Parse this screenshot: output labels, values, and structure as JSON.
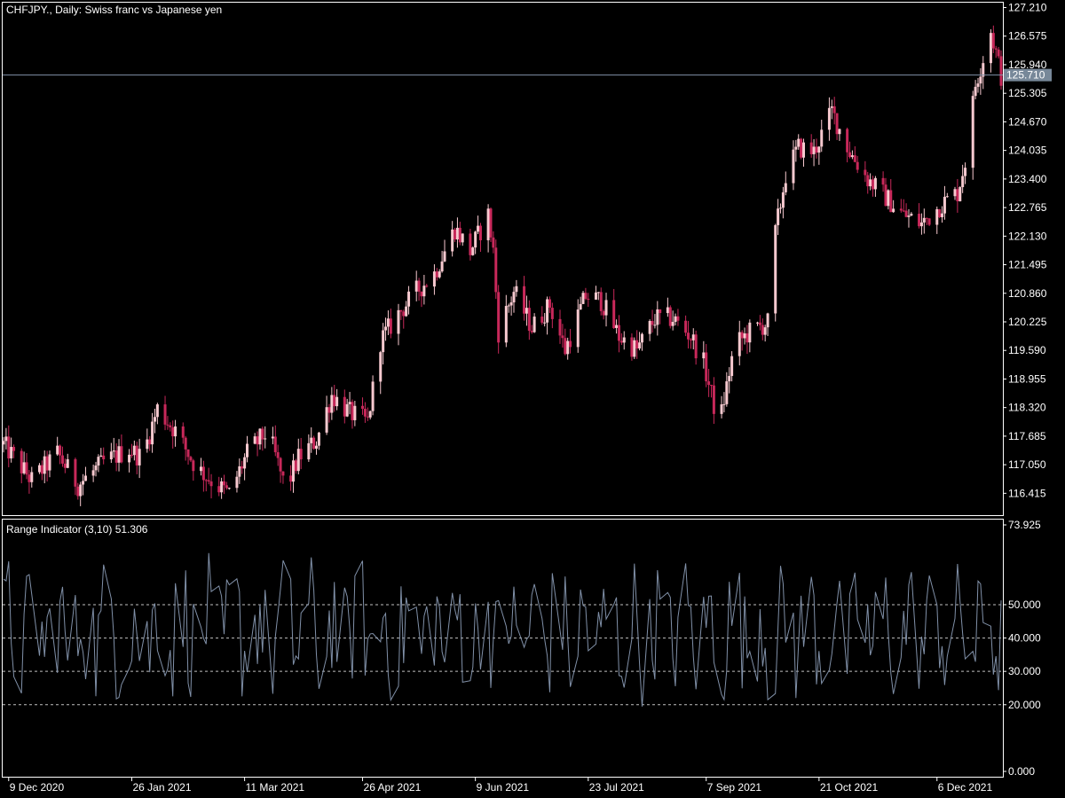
{
  "colors": {
    "background": "#000000",
    "frame": "#ffffff",
    "bull_candle": "#f7c9cf",
    "bear_candle": "#c8285a",
    "price_line": "#8090a8",
    "price_tag": "#778899",
    "indicator_line": "#8090a8",
    "level_line": "#c0c0c0"
  },
  "chart_data": [
    {
      "type": "candlestick",
      "title": "CHFJPY., Daily:  Swiss franc vs Japanese yen",
      "symbol": "CHFJPY.",
      "timeframe": "Daily",
      "ylim": [
        115.87,
        127.24
      ],
      "y_ticks": [
        "127.210",
        "126.575",
        "125.940",
        "125.305",
        "124.670",
        "124.035",
        "123.400",
        "122.765",
        "122.130",
        "121.495",
        "120.860",
        "120.225",
        "119.590",
        "118.955",
        "118.320",
        "117.685",
        "117.050",
        "116.415"
      ],
      "current_price": "125.710",
      "x_tick_labels": [
        "9 Dec 2020",
        "26 Jan 2021",
        "11 Mar 2021",
        "26 Apr 2021",
        "9 Jun 2021",
        "23 Jul 2021",
        "7 Sep 2021",
        "21 Oct 2021",
        "6 Dec 2021"
      ],
      "x_tick_dates": [
        "2020-12-09",
        "2021-01-26",
        "2021-03-11",
        "2021-04-26",
        "2021-06-09",
        "2021-07-23",
        "2021-09-07",
        "2021-10-21",
        "2021-12-06"
      ],
      "date_range": [
        "2020-12-07",
        "2021-12-31"
      ],
      "close_anchors": [
        [
          "2020-12-07",
          117.5
        ],
        [
          "2020-12-18",
          116.7
        ],
        [
          "2020-12-28",
          117.3
        ],
        [
          "2021-01-05",
          116.6
        ],
        [
          "2021-01-15",
          117.1
        ],
        [
          "2021-01-25",
          117.4
        ],
        [
          "2021-01-30",
          117.2
        ],
        [
          "2021-02-05",
          118.3
        ],
        [
          "2021-02-12",
          117.8
        ],
        [
          "2021-02-20",
          117.0
        ],
        [
          "2021-02-28",
          116.6
        ],
        [
          "2021-03-05",
          116.4
        ],
        [
          "2021-03-12",
          117.3
        ],
        [
          "2021-03-20",
          117.8
        ],
        [
          "2021-03-27",
          116.5
        ],
        [
          "2021-04-01",
          117.2
        ],
        [
          "2021-04-08",
          117.6
        ],
        [
          "2021-04-14",
          118.6
        ],
        [
          "2021-04-21",
          118.2
        ],
        [
          "2021-04-28",
          118.0
        ],
        [
          "2021-05-03",
          119.8
        ],
        [
          "2021-05-10",
          120.4
        ],
        [
          "2021-05-17",
          120.9
        ],
        [
          "2021-05-24",
          121.3
        ],
        [
          "2021-06-01",
          122.3
        ],
        [
          "2021-06-07",
          121.8
        ],
        [
          "2021-06-14",
          122.6
        ],
        [
          "2021-06-16",
          121.8
        ],
        [
          "2021-06-18",
          120.0
        ],
        [
          "2021-06-24",
          120.9
        ],
        [
          "2021-07-01",
          120.1
        ],
        [
          "2021-07-08",
          120.6
        ],
        [
          "2021-07-14",
          119.6
        ],
        [
          "2021-07-22",
          120.8
        ],
        [
          "2021-07-28",
          120.7
        ],
        [
          "2021-08-04",
          119.9
        ],
        [
          "2021-08-11",
          119.6
        ],
        [
          "2021-08-18",
          120.3
        ],
        [
          "2021-08-25",
          120.3
        ],
        [
          "2021-09-01",
          119.9
        ],
        [
          "2021-09-06",
          119.3
        ],
        [
          "2021-09-12",
          117.9
        ],
        [
          "2021-09-18",
          119.7
        ],
        [
          "2021-09-24",
          120.0
        ],
        [
          "2021-10-01",
          120.2
        ],
        [
          "2021-10-04",
          122.2
        ],
        [
          "2021-10-08",
          123.5
        ],
        [
          "2021-10-13",
          124.1
        ],
        [
          "2021-10-19",
          124.0
        ],
        [
          "2021-10-26",
          124.9
        ],
        [
          "2021-11-02",
          124.0
        ],
        [
          "2021-11-09",
          123.4
        ],
        [
          "2021-11-16",
          123.0
        ],
        [
          "2021-11-23",
          122.6
        ],
        [
          "2021-11-30",
          122.4
        ],
        [
          "2021-12-07",
          122.8
        ],
        [
          "2021-12-14",
          123.1
        ],
        [
          "2021-12-17",
          123.8
        ],
        [
          "2021-12-21",
          125.5
        ],
        [
          "2021-12-27",
          126.7
        ],
        [
          "2021-12-31",
          125.7
        ]
      ]
    },
    {
      "type": "line",
      "title": "Range Indicator (3,10) 51.306",
      "ylim": [
        0,
        73.925
      ],
      "y_ticks": [
        "73.925",
        "50.000",
        "40.000",
        "30.000",
        "20.000",
        "0.000"
      ],
      "levels": [
        50,
        40,
        30,
        20
      ],
      "last_value": 51.306
    }
  ]
}
